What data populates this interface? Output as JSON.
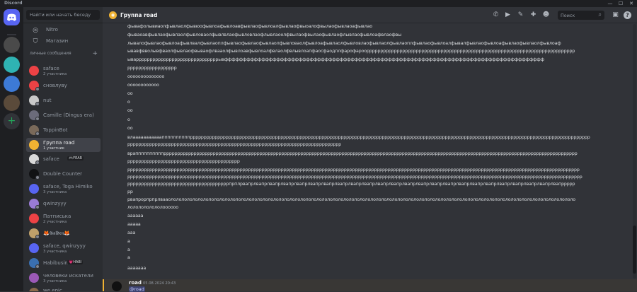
{
  "app": {
    "title": "Discord"
  },
  "window": {
    "minimize": "—",
    "maximize": "☐",
    "close": "✕"
  },
  "sidebar": {
    "search_placeholder": "Найти или начать беседу",
    "nav": [
      {
        "label": "Nitro",
        "icon": "nitro-icon"
      },
      {
        "label": "Магазин",
        "icon": "shop-icon"
      }
    ],
    "dm_header": "личные сообщения",
    "dm_add": "+",
    "dms": [
      {
        "name": "saface",
        "sub": "2 участника",
        "color": "#ed4245"
      },
      {
        "name": "сновлуву",
        "sub": "",
        "color": "#ed4245"
      },
      {
        "name": "nut",
        "sub": "",
        "color": "#c9c9c9"
      },
      {
        "name": "Camille (Dingus era)",
        "sub": "",
        "color": "#6b6b7a"
      },
      {
        "name": "ToppinBot",
        "sub": "",
        "color": "#7a6a5a"
      },
      {
        "name": "Группа road",
        "sub": "1 участник",
        "color": "#f0b232",
        "active": true
      },
      {
        "name": "saface",
        "tag": "🎮FEAR",
        "sub": "",
        "color": "#d9d9d9"
      },
      {
        "name": "Double Counter",
        "sub": "",
        "color": "#111214"
      },
      {
        "name": "saface, Toga Himiko",
        "sub": "3 участника",
        "color": "#5865f2"
      },
      {
        "name": "qwinzyyy",
        "sub": "",
        "color": "#9a7bd6"
      },
      {
        "name": "Патписька",
        "sub": "2 участника",
        "color": "#ed4245"
      },
      {
        "name": "🦊𝕲𝖔𝖑𝖉𝖊𝖓🦊",
        "sub": "",
        "color": "#bfa06a"
      },
      {
        "name": "saface, qwinzyyy",
        "sub": "3 участника",
        "color": "#5865f2"
      },
      {
        "name": "Habibusin",
        "tag": "💗HABI",
        "sub": "",
        "color": "#3a6fb0"
      },
      {
        "name": "человеки искатели",
        "sub": "3 участника",
        "color": "#9b59b6"
      },
      {
        "name": "we epic",
        "sub": "3 участника",
        "color": "#8a6a4a"
      }
    ]
  },
  "header": {
    "title": "Группа road",
    "search_placeholder": "Поиск",
    "icons": [
      "phone-call-icon",
      "video-call-icon",
      "pin-icon",
      "add-member-icon",
      "members-icon",
      "inbox-icon",
      "help-icon"
    ]
  },
  "messages": [
    "фывафолывиаолфывлаолфывюофывлоафывлоавфывлаофывлоалфывлаофвыоалофвылаофывлаоафывлао",
    "фываоавфывлаофывлаолфывловаолфывлвлаофывловлаофлывлаоолфвылаофвылаофывлаофлывлаофывлоафвлаофвы",
    "лывалофывлаофывлоафывлвалфывлаоплфывлаофывлаофывлаолфывловаолфывлоафывлаолфывловлаофывлаолфывлаоплфывлаофывлоалфывалфывлаофывлоафывлаофывлаолфывлоаф",
    "ывавфвволывфваолфывлаофвываофлвааолфывлоавфывлоалфвлаолфвлывлоапфаосфаодплфарофароорррррррррррррррррррррррррррррррррррррррррррррррррррррррррррррррррррррррррррр",
    "ываррррррррррррррррррррррррррррррывфффффффффффффффффффффффффффффффффффффффффффффффффффффффффффффффффффффффффффффффффффффф",
    "рррррррррррррррррр",
    "оооооооооооооо",
    "оооооооооооо",
    "оо",
    "о",
    "оо",
    "о",
    "оо",
    "влаааааааааааппппппппппрррррррррррррррррррррррррррррррррррррррррррррррррррррррррррррррррррррррррррррррррррррррррррррррррррррррррррррррррррррррррррррррррррррррррррррррррр",
    "рррррррррррррррррррррррррррррррррррррррррррррррррррррррррррррррррррррррррррррр",
    "враппппппппппррррррррррррррррррррррррррррррррррррррррррррррррррррррррррррррррррррррррррррррррррррррррррррррррррррррррррррррррррррррррррррррррррррррррррррррррррррррр",
    "ррррррррррррррррррррррррррррррррррррррррр",
    "ррррррррррррррррррррррррррррррррррррррррррррррррррррррррррррррррррррррррррррррррррррррррррррррррррррррррррррррррррррррррррррррррррррррррррррррррррррррррррррррррррррр",
    "рррррррррррррррррррррррррррррррррррррррррррррррррррррррррррррррррррррррррррррррррррррррррррррррррррррррррррррррррррррррррррррррррррррррррррррррррррррррррррррррррррррр",
    "рррррррррррррррррррррррррррррррррррррпрплрвапрлвапрлвапрлвапрлвапрлвапрлвапрлвапрлвапрлвапрлвапрлвапрлвапрлвапрлвапрлвапрлвапрлвапрлвапрлвапрлвапрлвапрлвапрлвапррррр",
    "рр",
    "рвапрорпрпрлвааолололололололололололололололололололололололололололололололололололололололололололололололололололололололололололололололололололололололололололо",
    "лололололололоооооо",
    "аааааа",
    "ааааа",
    "ааа",
    "а",
    "а",
    "а",
    "ааааааа"
  ],
  "new_message": {
    "author": "road",
    "timestamp": "05.08.2024 20:43",
    "mention": "@road"
  }
}
